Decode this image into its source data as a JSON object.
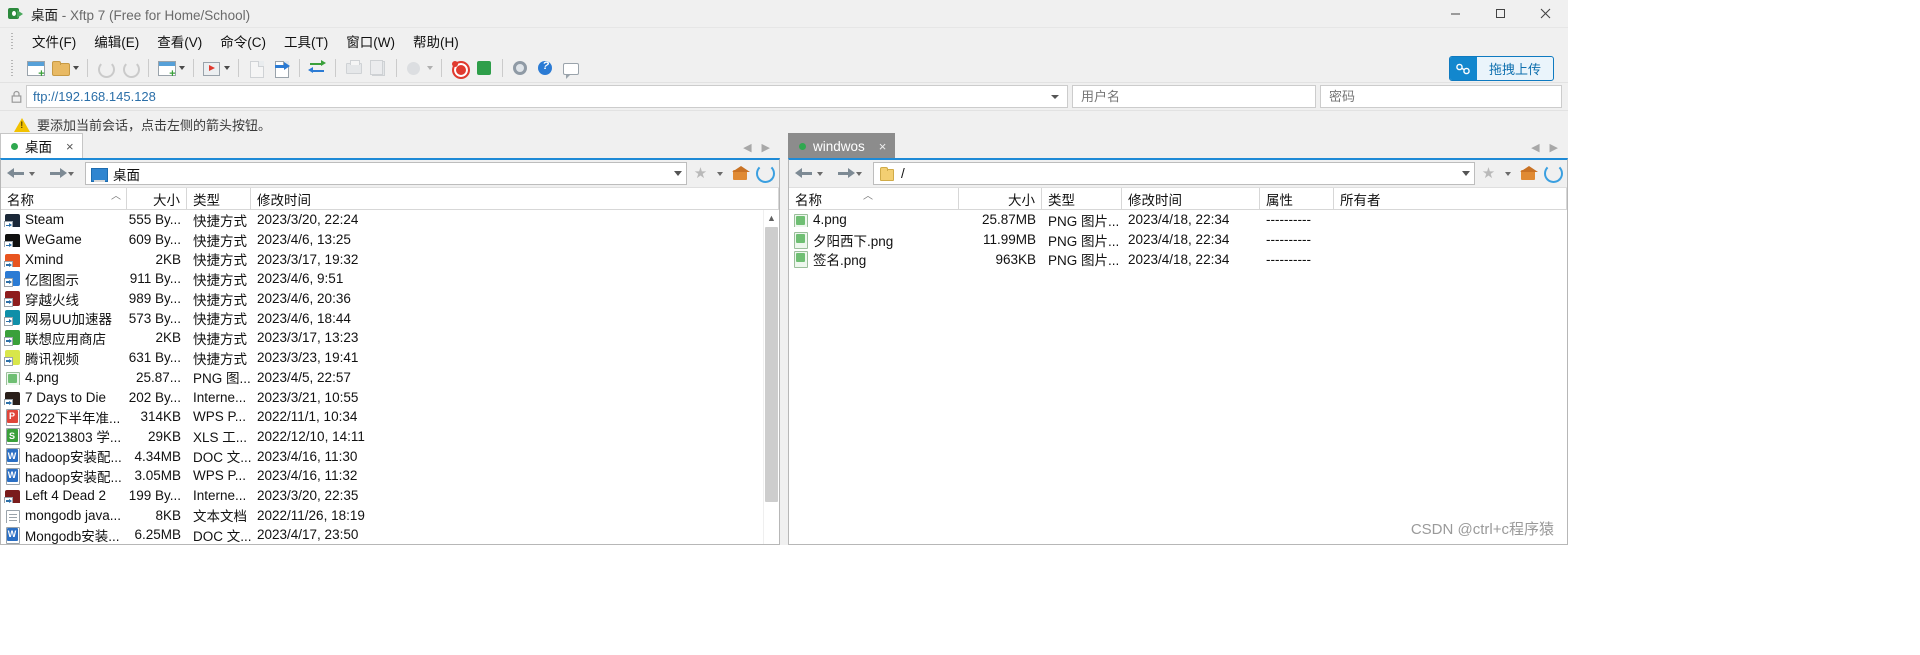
{
  "window": {
    "title_main": "桌面",
    "title_rest": "- Xftp 7 (Free for Home/School)",
    "minimize": "minimize-icon",
    "maximize": "maximize-icon",
    "close": "close-icon"
  },
  "menubar": {
    "items": [
      {
        "label": "文件(F)",
        "name": "menu-file"
      },
      {
        "label": "编辑(E)",
        "name": "menu-edit"
      },
      {
        "label": "查看(V)",
        "name": "menu-view"
      },
      {
        "label": "命令(C)",
        "name": "menu-command"
      },
      {
        "label": "工具(T)",
        "name": "menu-tools"
      },
      {
        "label": "窗口(W)",
        "name": "menu-window"
      },
      {
        "label": "帮助(H)",
        "name": "menu-help"
      }
    ]
  },
  "toolbar": {
    "upload_label": "拖拽上传",
    "upload_accent": "#1287ce"
  },
  "address": {
    "url": "ftp://192.168.145.128",
    "username_placeholder": "用户名",
    "username_value": "",
    "password_placeholder": "密码",
    "password_value": ""
  },
  "infobar": {
    "message": "要添加当前会话，点击左侧的箭头按钮。"
  },
  "left_panel": {
    "tab_label": "桌面",
    "tab_close": "×",
    "path": "桌面",
    "columns": [
      "名称",
      "大小",
      "类型",
      "修改时间"
    ],
    "sorted_column": "名称",
    "rows": [
      {
        "name": "Steam",
        "size": "555 By...",
        "type": "快捷方式",
        "modified": "2023/3/20, 22:24",
        "icon": "shortcut-steam",
        "color": "#1b2838"
      },
      {
        "name": "WeGame",
        "size": "609 By...",
        "type": "快捷方式",
        "modified": "2023/4/6, 13:25",
        "icon": "shortcut-wegame",
        "color": "#10100f"
      },
      {
        "name": "Xmind",
        "size": "2KB",
        "type": "快捷方式",
        "modified": "2023/3/17, 19:32",
        "icon": "shortcut-xmind",
        "color": "#e8541f"
      },
      {
        "name": "亿图图示",
        "size": "911 By...",
        "type": "快捷方式",
        "modified": "2023/4/6, 9:51",
        "icon": "shortcut-edraw",
        "color": "#2b7bd4"
      },
      {
        "name": "穿越火线",
        "size": "989 By...",
        "type": "快捷方式",
        "modified": "2023/4/6, 20:36",
        "icon": "shortcut-cf",
        "color": "#8e1d1d"
      },
      {
        "name": "网易UU加速器",
        "size": "573 By...",
        "type": "快捷方式",
        "modified": "2023/4/6, 18:44",
        "icon": "shortcut-uu",
        "color": "#0f8fa8"
      },
      {
        "name": "联想应用商店",
        "size": "2KB",
        "type": "快捷方式",
        "modified": "2023/3/17, 13:23",
        "icon": "shortcut-lenovo",
        "color": "#3aa03a"
      },
      {
        "name": "腾讯视频",
        "size": "631 By...",
        "type": "快捷方式",
        "modified": "2023/3/23, 19:41",
        "icon": "shortcut-txvideo",
        "color": "#d8e64a"
      },
      {
        "name": "4.png",
        "size": "25.87...",
        "type": "PNG 图...",
        "modified": "2023/4/5, 22:57",
        "icon": "png-file",
        "color": "#6fbf73"
      },
      {
        "name": "7 Days to Die",
        "size": "202 By...",
        "type": "Interne...",
        "modified": "2023/3/21, 10:55",
        "icon": "shortcut-7dtd",
        "color": "#2a1f1a"
      },
      {
        "name": "2022下半年准...",
        "size": "314KB",
        "type": "WPS P...",
        "modified": "2022/11/1, 10:34",
        "icon": "wps-ppt-file",
        "color": "#e0453a"
      },
      {
        "name": "920213803 学...",
        "size": "29KB",
        "type": "XLS 工...",
        "modified": "2022/12/10, 14:11",
        "icon": "xls-file",
        "color": "#3aa03a"
      },
      {
        "name": "hadoop安装配...",
        "size": "4.34MB",
        "type": "DOC 文...",
        "modified": "2023/4/16, 11:30",
        "icon": "doc-file",
        "color": "#2b6fc4"
      },
      {
        "name": "hadoop安装配...",
        "size": "3.05MB",
        "type": "WPS P...",
        "modified": "2023/4/16, 11:32",
        "icon": "wps-doc-file",
        "color": "#2b6fc4"
      },
      {
        "name": "Left 4 Dead 2",
        "size": "199 By...",
        "type": "Interne...",
        "modified": "2023/3/20, 22:35",
        "icon": "shortcut-l4d2",
        "color": "#7a1c1c"
      },
      {
        "name": "mongodb java...",
        "size": "8KB",
        "type": "文本文档",
        "modified": "2022/11/26, 18:19",
        "icon": "txt-file",
        "color": "#b9c4cc"
      },
      {
        "name": "Mongodb安装...",
        "size": "6.25MB",
        "type": "DOC 文...",
        "modified": "2023/4/17, 23:50",
        "icon": "doc-file",
        "color": "#2b6fc4"
      }
    ]
  },
  "right_panel": {
    "tab_label": "windwos",
    "tab_close": "×",
    "path": "/",
    "columns": [
      "名称",
      "大小",
      "类型",
      "修改时间",
      "属性",
      "所有者"
    ],
    "sorted_column": "名称",
    "rows": [
      {
        "name": "4.png",
        "size": "25.87MB",
        "type": "PNG 图片...",
        "modified": "2023/4/18, 22:34",
        "attributes": "----------",
        "owner": "",
        "icon": "png-file",
        "color": "#6fbf73"
      },
      {
        "name": "夕阳西下.png",
        "size": "11.99MB",
        "type": "PNG 图片...",
        "modified": "2023/4/18, 22:34",
        "attributes": "----------",
        "owner": "",
        "icon": "png-file",
        "color": "#6fbf73"
      },
      {
        "name": "签名.png",
        "size": "963KB",
        "type": "PNG 图片...",
        "modified": "2023/4/18, 22:34",
        "attributes": "----------",
        "owner": "",
        "icon": "png-file",
        "color": "#6fbf73"
      }
    ]
  },
  "watermark": {
    "text": "CSDN @ctrl+c程序猿"
  }
}
